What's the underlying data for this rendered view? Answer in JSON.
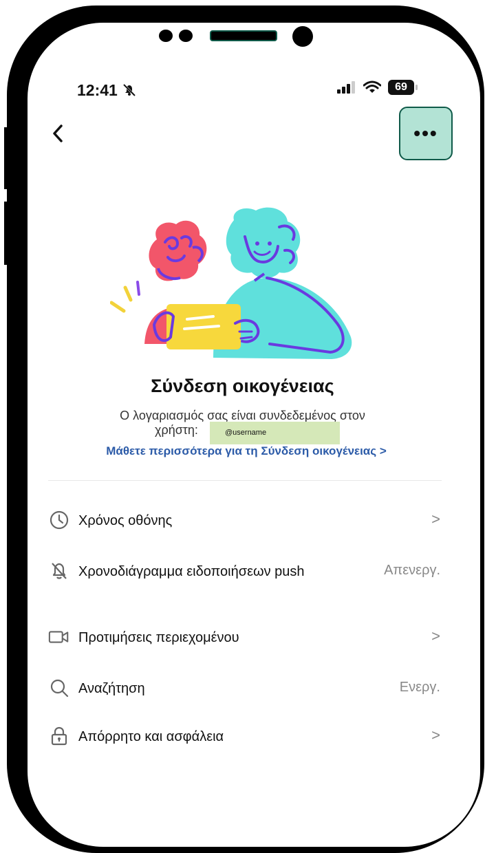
{
  "status_bar": {
    "time": "12:41",
    "battery": "69"
  },
  "header": {
    "back_icon": "chevron-left-icon",
    "more_icon": "ellipsis-icon",
    "more_label": "•••"
  },
  "family": {
    "title": "Σύνδεση οικογένειας",
    "description_line1": "Ο λογαριασμός σας είναι συνδεδεμένος στον",
    "description_line2": "χρήστη:",
    "username": "@username",
    "learn_more": "Μάθετε περισσότερα για τη Σύνδεση οικογένειας >"
  },
  "settings": [
    {
      "label": "Χρόνος οθόνης",
      "icon": "clock-icon",
      "value": "",
      "chevron": ">"
    },
    {
      "label": "Χρονοδιάγραμμα ειδοποιήσεων push",
      "icon": "bell-off-icon",
      "value": "Απενεργ.",
      "chevron": ""
    },
    {
      "label": "Προτιμήσεις περιεχομένου",
      "icon": "video-icon",
      "value": "",
      "chevron": ">"
    },
    {
      "label": "Αναζήτηση",
      "icon": "search-icon",
      "value": "Ενεργ.",
      "chevron": ""
    },
    {
      "label": "Απόρρητο και ασφάλεια",
      "icon": "lock-icon",
      "value": "",
      "chevron": ">"
    }
  ],
  "colors": {
    "more_button_bg": "#b3e3d5",
    "link": "#2c5ba8",
    "username_highlight": "#d5e8b8"
  }
}
